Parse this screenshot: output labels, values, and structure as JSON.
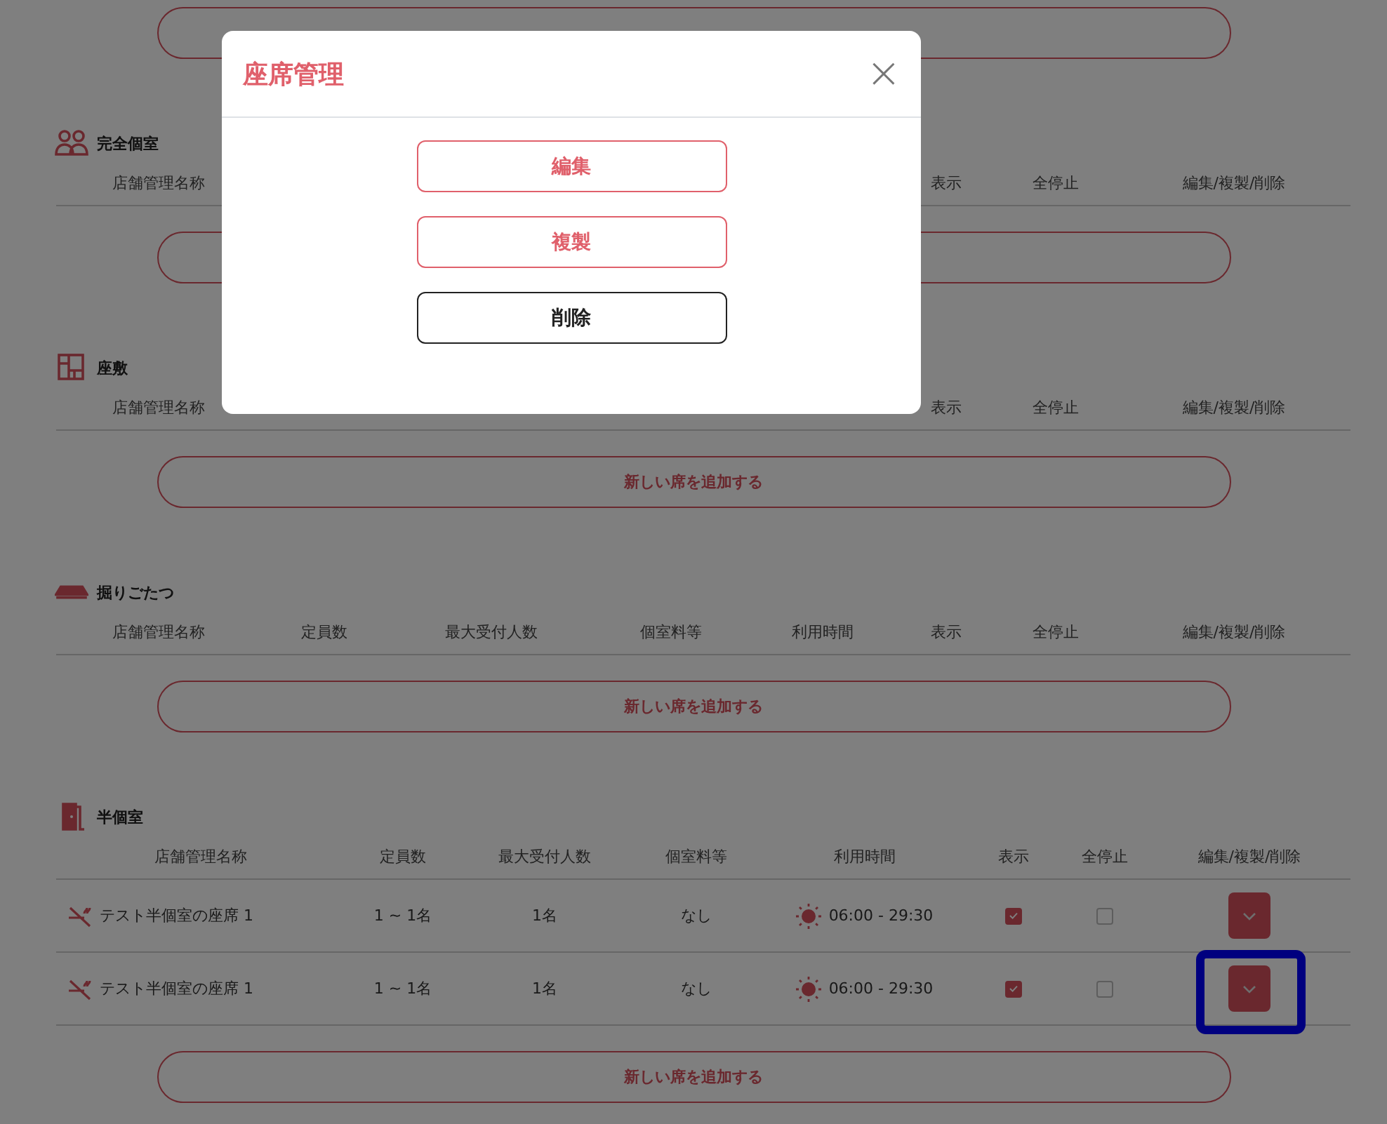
{
  "sections": [
    {
      "title": "完全個室",
      "columns": [
        "店舗管理名称",
        "表示",
        "全停止",
        "編集/複製/削除"
      ]
    },
    {
      "title": "座敷",
      "columns": [
        "店舗管理名称",
        "表示",
        "全停止",
        "編集/複製/削除"
      ],
      "add_button": {
        "label": "新しい席を追加する"
      }
    },
    {
      "title": "掘りごたつ",
      "columns": [
        "店舗管理名称",
        "定員数",
        "最大受付人数",
        "個室料等",
        "利用時間",
        "表示",
        "全停止",
        "編集/複製/削除"
      ],
      "add_button": {
        "label": "新しい席を追加する"
      }
    },
    {
      "title": "半個室",
      "columns": [
        "店舗管理名称",
        "定員数",
        "最大受付人数",
        "個室料等",
        "利用時間",
        "表示",
        "全停止",
        "編集/複製/削除"
      ],
      "rows": [
        {
          "name": "テスト半個室の座席 1",
          "capacity": "1 ~ 1名",
          "max": "1名",
          "fee": "なし",
          "hours": "06:00 - 29:30",
          "visible": true,
          "stopped": false,
          "highlighted": false
        },
        {
          "name": "テスト半個室の座席 1",
          "capacity": "1 ~ 1名",
          "max": "1名",
          "fee": "なし",
          "hours": "06:00 - 29:30",
          "visible": true,
          "stopped": false,
          "highlighted": true
        }
      ],
      "add_button": {
        "label": "新しい席を追加する"
      }
    }
  ],
  "modal": {
    "title": "座席管理",
    "close": "×",
    "actions": [
      {
        "label": "編集",
        "kind": "primary"
      },
      {
        "label": "複製",
        "kind": "primary"
      },
      {
        "label": "削除",
        "kind": "danger"
      }
    ]
  }
}
